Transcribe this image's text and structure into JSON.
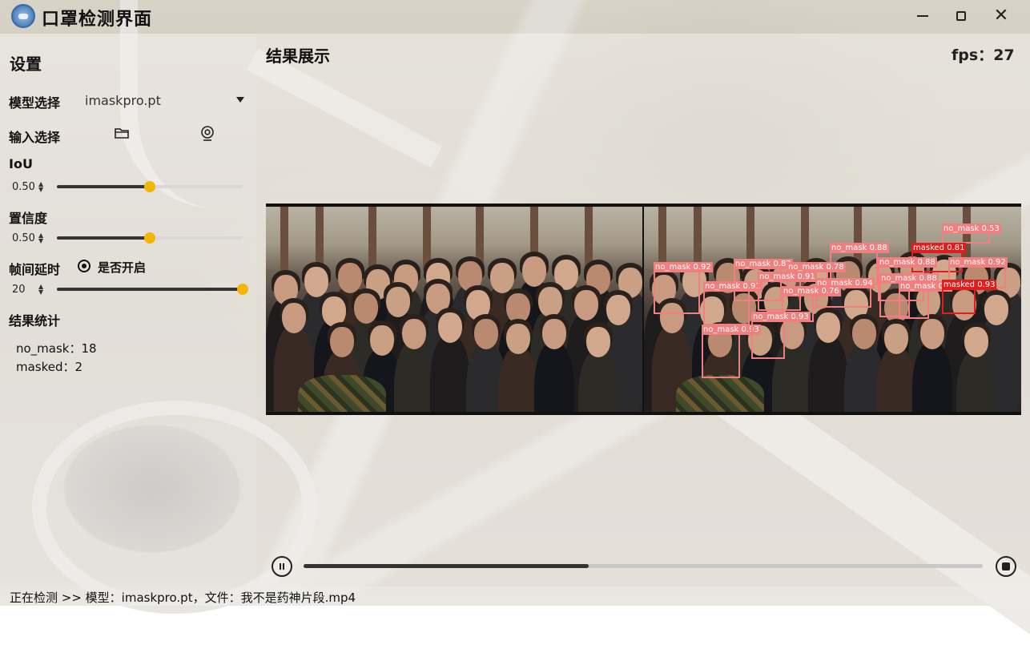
{
  "window": {
    "title": "口罩检测界面",
    "logo_icon": "mask-logo-icon",
    "minimize_icon": "minimize-icon",
    "maximize_icon": "maximize-icon",
    "close_icon": "close-icon",
    "close_glyph": "✕"
  },
  "sidebar": {
    "title": "设置",
    "model": {
      "label": "模型选择",
      "value": "imaskpro.pt"
    },
    "input": {
      "label": "输入选择",
      "file_icon": "folder-icon",
      "camera_icon": "camera-icon"
    },
    "iou": {
      "label": "IoU",
      "value": "0.50",
      "level": 0.5
    },
    "confidence": {
      "label": "置信度",
      "value": "0.50",
      "level": 0.5
    },
    "frame_delay": {
      "label": "帧间延时",
      "toggle_label": "是否开启",
      "toggle_on": true,
      "value": "20",
      "level": 1.0
    },
    "stats": {
      "label": "结果统计",
      "items": [
        "no_mask：18",
        "masked：2"
      ]
    }
  },
  "main": {
    "title": "结果展示",
    "fps_label": "fps：",
    "fps_value": "27",
    "detections": [
      "no_mask 0.53",
      "no_mask 0.88",
      "masked 0.81",
      "no_mask 0.92",
      "no_mask 0.82",
      "no_mask 0.78",
      "no_mask 0.88",
      "no_mask 0.92",
      "no_mask 0.91",
      "no_mask 0.91",
      "no_mask 0.94",
      "no_mask 0.88",
      "no_mask 0.9",
      "no_mask 0.76",
      "masked 0.93",
      "no_mask 0.93",
      "no_mask 0.93"
    ],
    "playback": {
      "pause_icon": "pause-icon",
      "stop_icon": "stop-icon",
      "progress": 0.42
    }
  },
  "status": {
    "text": "正在检测 >> 模型：imaskpro.pt，文件：我不是药神片段.mp4"
  },
  "colors": {
    "accent": "#f2b705",
    "no_mask_box": "#f08080",
    "masked_box": "#e01e1e"
  }
}
